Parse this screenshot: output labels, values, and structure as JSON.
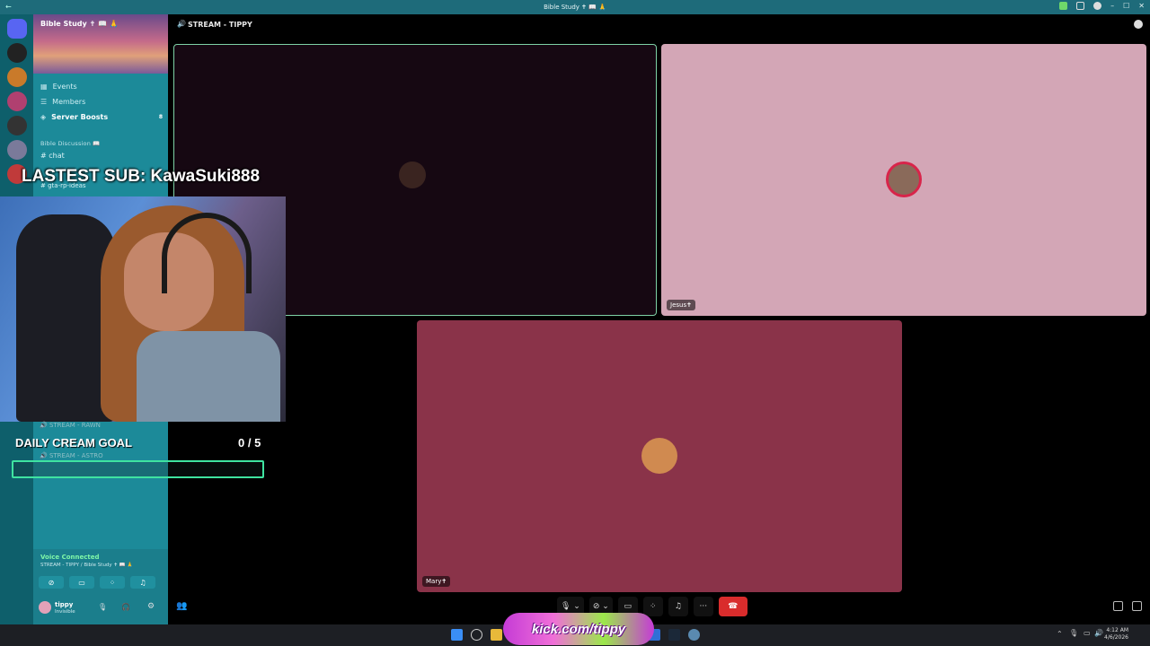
{
  "window": {
    "title": "Bible Study ✝ 📖 🙏"
  },
  "sidebar": {
    "server_name": "Bible Study ✝ 📖 🙏",
    "items": [
      {
        "label": "Events",
        "icon": "calendar-icon"
      },
      {
        "label": "Members",
        "icon": "members-icon"
      },
      {
        "label": "Server Boosts",
        "icon": "boost-icon",
        "badge": "8"
      }
    ],
    "category": "Bible Discussion 📖",
    "channels": [
      "chat",
      "gta-rp-ideas"
    ],
    "voice_channels": [
      "STREAM - RAWN",
      "STREAM - ASTRO"
    ]
  },
  "voice": {
    "status": "Voice Connected",
    "channel": "STREAM - TIPPY / Bible Study ✝ 📖 🙏"
  },
  "user": {
    "name": "tippy",
    "status": "Invisible"
  },
  "main": {
    "channel_title": "STREAM - TIPPY",
    "tiles": [
      {
        "name": ""
      },
      {
        "name": "Jesus✝"
      },
      {
        "name": "Mary✝"
      }
    ]
  },
  "overlay": {
    "latest_sub": "LASTEST SUB: KawaSuki888",
    "goal_title": "DAILY CREAM GOAL",
    "goal_count": "0 / 5",
    "goal_progress": 0,
    "kick_text": "kick.com/tippy"
  },
  "taskbar": {
    "time": "4:12 AM",
    "date": "4/6/2026"
  },
  "colors": {
    "rail": "#0e5f6b",
    "sidebar": "#1c8a99",
    "accent_green": "#3fe3a0",
    "end_call": "#d92c2c",
    "tile_jesus": "#d3a6b6",
    "tile_mary": "#8a3349"
  }
}
